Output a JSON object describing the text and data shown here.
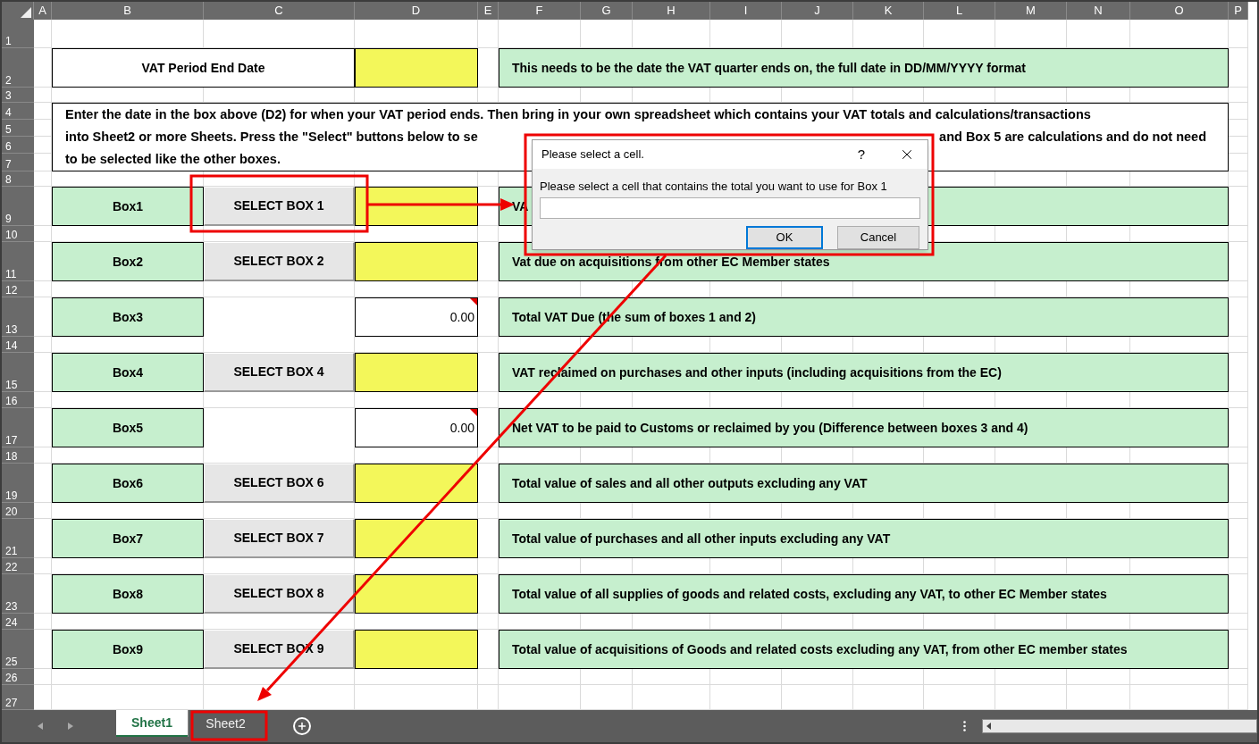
{
  "columns": [
    "A",
    "B",
    "C",
    "D",
    "E",
    "F",
    "G",
    "H",
    "I",
    "J",
    "K",
    "L",
    "M",
    "N",
    "O",
    "P"
  ],
  "row_numbers": [
    "1",
    "2",
    "3",
    "4",
    "5",
    "6",
    "7",
    "8",
    "9",
    "10",
    "11",
    "12",
    "13",
    "14",
    "15",
    "16",
    "17",
    "18",
    "19",
    "20",
    "21",
    "22",
    "23",
    "24",
    "25",
    "26",
    "27"
  ],
  "period": {
    "label": "VAT Period End Date",
    "note": "This needs to be the date the VAT quarter ends on, the full date in DD/MM/YYYY format"
  },
  "instructions": {
    "line_1": "Enter the date in the box above (D2) for when your VAT period ends. Then bring in your own spreadsheet which contains your VAT totals and calculations/transactions",
    "line_2_start": "into Sheet2 or more Sheets. Press the \"Select\" buttons below to se",
    "line_2_end": "and Box 5 are calculations and do not need",
    "line_3": "to be selected like the other boxes."
  },
  "boxes": [
    {
      "label": "Box1",
      "kind": "select",
      "button": "SELECT BOX 1",
      "description": "VA"
    },
    {
      "label": "Box2",
      "kind": "select",
      "button": "SELECT BOX 2",
      "description": "Vat due on acquisitions from other EC Member states"
    },
    {
      "label": "Box3",
      "kind": "calculated",
      "value": "0.00",
      "description": "Total VAT Due (the sum of boxes 1 and 2)"
    },
    {
      "label": "Box4",
      "kind": "select",
      "button": "SELECT BOX 4",
      "description": "VAT reclaimed on purchases and other inputs (including acquisitions from the EC)"
    },
    {
      "label": "Box5",
      "kind": "calculated",
      "value": "0.00",
      "description": "Net VAT to be paid to Customs or reclaimed by you (Difference between boxes 3 and 4)"
    },
    {
      "label": "Box6",
      "kind": "select",
      "button": "SELECT BOX 6",
      "description": "Total value of sales and all other outputs excluding any VAT"
    },
    {
      "label": "Box7",
      "kind": "select",
      "button": "SELECT BOX 7",
      "description": "Total value of purchases and all other inputs excluding any VAT"
    },
    {
      "label": "Box8",
      "kind": "select",
      "button": "SELECT BOX 8",
      "description": "Total value of all supplies of goods and related costs, excluding any VAT, to other EC Member states"
    },
    {
      "label": "Box9",
      "kind": "select",
      "button": "SELECT BOX 9",
      "description": "Total value of acquisitions of Goods and related costs excluding any VAT, from other EC member states"
    }
  ],
  "dialog": {
    "title": "Please select a cell.",
    "help": "?",
    "prompt": "Please select a cell that contains the total you want to use for Box 1",
    "buttons": [
      {
        "label": "OK",
        "default": true
      },
      {
        "label": "Cancel",
        "default": false
      }
    ]
  },
  "sheet_tabs": [
    {
      "label": "Sheet1",
      "selected": true
    },
    {
      "label": "Sheet2",
      "selected": false
    }
  ]
}
